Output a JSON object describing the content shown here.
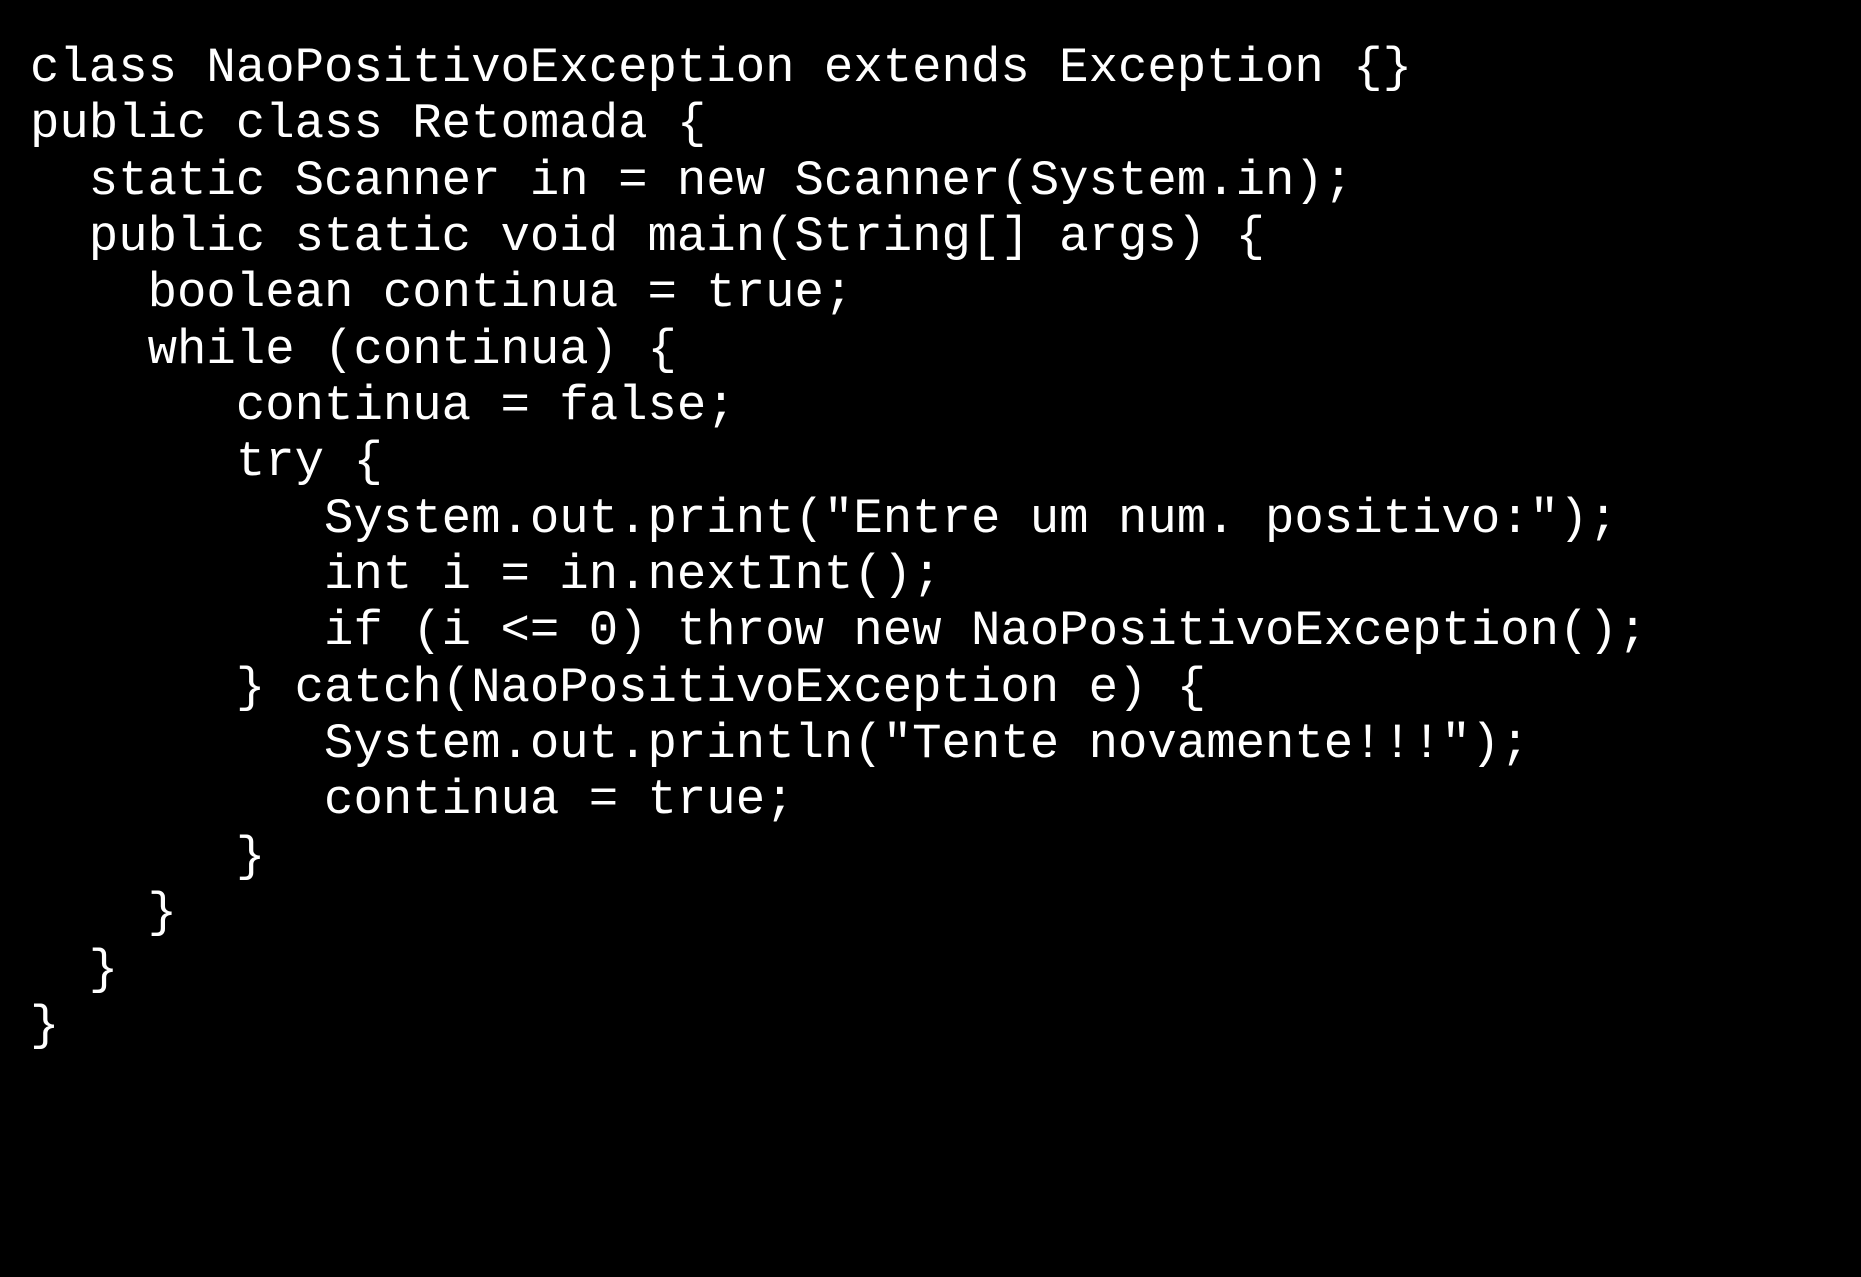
{
  "code": {
    "lines": [
      "class NaoPositivoException extends Exception {}",
      "public class Retomada {",
      "  static Scanner in = new Scanner(System.in);",
      "  public static void main(String[] args) {",
      "    boolean continua = true;",
      "    while (continua) {",
      "       continua = false;",
      "       try {",
      "          System.out.print(\"Entre um num. positivo:\");",
      "          int i = in.nextInt();",
      "          if (i <= 0) throw new NaoPositivoException();",
      "       } catch(NaoPositivoException e) {",
      "          System.out.println(\"Tente novamente!!!\");",
      "          continua = true;",
      "       }",
      "    }",
      "  }",
      "}"
    ]
  }
}
